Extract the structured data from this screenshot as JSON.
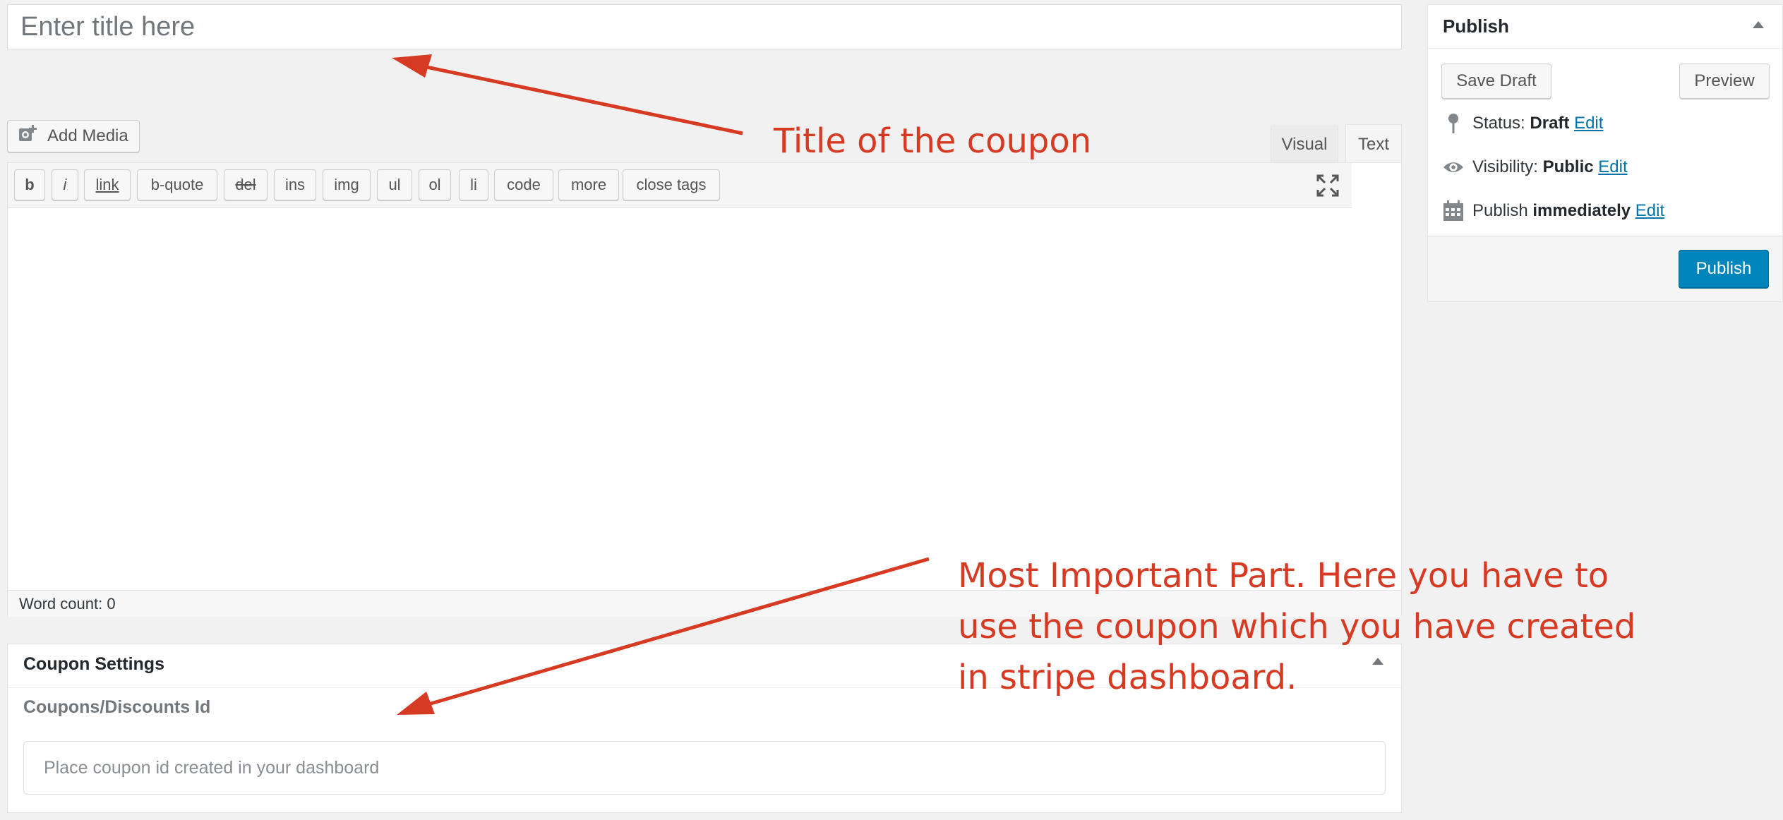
{
  "title": {
    "placeholder": "Enter title here"
  },
  "media": {
    "add_media_label": "Add Media"
  },
  "editor": {
    "tabs": {
      "visual": "Visual",
      "text": "Text"
    },
    "quicktags": [
      "b",
      "i",
      "link",
      "b-quote",
      "del",
      "ins",
      "img",
      "ul",
      "ol",
      "li",
      "code",
      "more",
      "close tags"
    ],
    "word_count": "Word count: 0"
  },
  "coupon_settings": {
    "title": "Coupon Settings",
    "field_label": "Coupons/Discounts Id",
    "placeholder": "Place coupon id created in your dashboard"
  },
  "publish": {
    "title": "Publish",
    "save_draft": "Save Draft",
    "preview": "Preview",
    "status_label": "Status:",
    "status_value": "Draft",
    "visibility_label": "Visibility:",
    "visibility_value": "Public",
    "schedule_label": "Publish",
    "schedule_value": "immediately",
    "edit_link": "Edit",
    "publish_button": "Publish"
  },
  "annotations": {
    "title_note": "Title of the coupon",
    "coupon_note": "Most Important Part. Here you have to use the coupon which you have created in stripe dashboard.",
    "color": "#d63a22"
  },
  "colors": {
    "primary_button": "#0085ba",
    "link": "#0073aa",
    "page_background": "#f1f1f1"
  }
}
